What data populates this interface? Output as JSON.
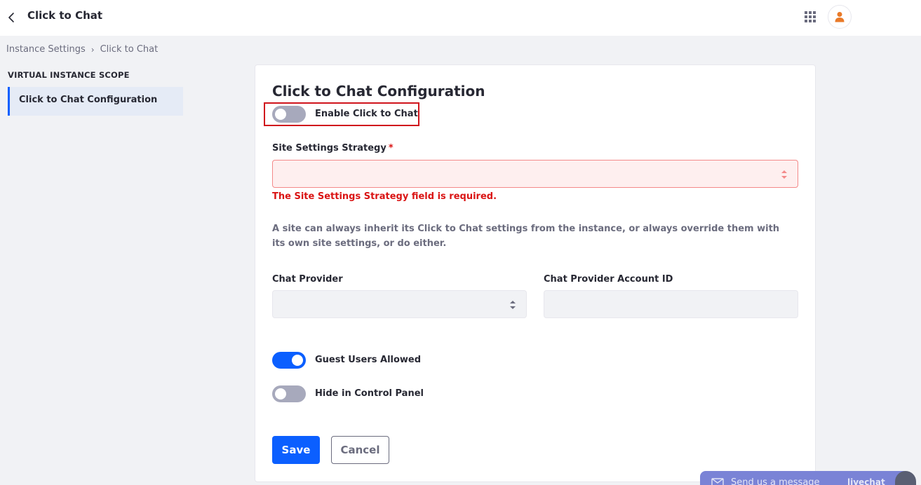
{
  "header": {
    "title": "Click to Chat"
  },
  "breadcrumb": {
    "items": [
      "Instance Settings",
      "Click to Chat"
    ]
  },
  "sidebar": {
    "heading": "VIRTUAL INSTANCE SCOPE",
    "items": [
      {
        "label": "Click to Chat Configuration",
        "active": true
      }
    ]
  },
  "form": {
    "title": "Click to Chat Configuration",
    "enable_toggle": {
      "label": "Enable Click to Chat",
      "checked": false
    },
    "site_settings_strategy": {
      "label": "Site Settings Strategy",
      "required_mark": "*",
      "value": "",
      "error": "The Site Settings Strategy field is required."
    },
    "help_text": "A site can always inherit its Click to Chat settings from the instance, or always override them with its own site settings, or do either.",
    "chat_provider": {
      "label": "Chat Provider",
      "value": ""
    },
    "chat_provider_account_id": {
      "label": "Chat Provider Account ID",
      "value": ""
    },
    "guest_users_toggle": {
      "label": "Guest Users Allowed",
      "checked": true
    },
    "hide_control_panel_toggle": {
      "label": "Hide in Control Panel",
      "checked": false
    },
    "save_label": "Save",
    "cancel_label": "Cancel"
  },
  "chat_widget": {
    "message": "Send us a message",
    "brand": "livechat"
  },
  "colors": {
    "primary": "#0b5fff",
    "error": "#da1414",
    "error_bg": "#feefef",
    "highlight": "#d0141c"
  }
}
